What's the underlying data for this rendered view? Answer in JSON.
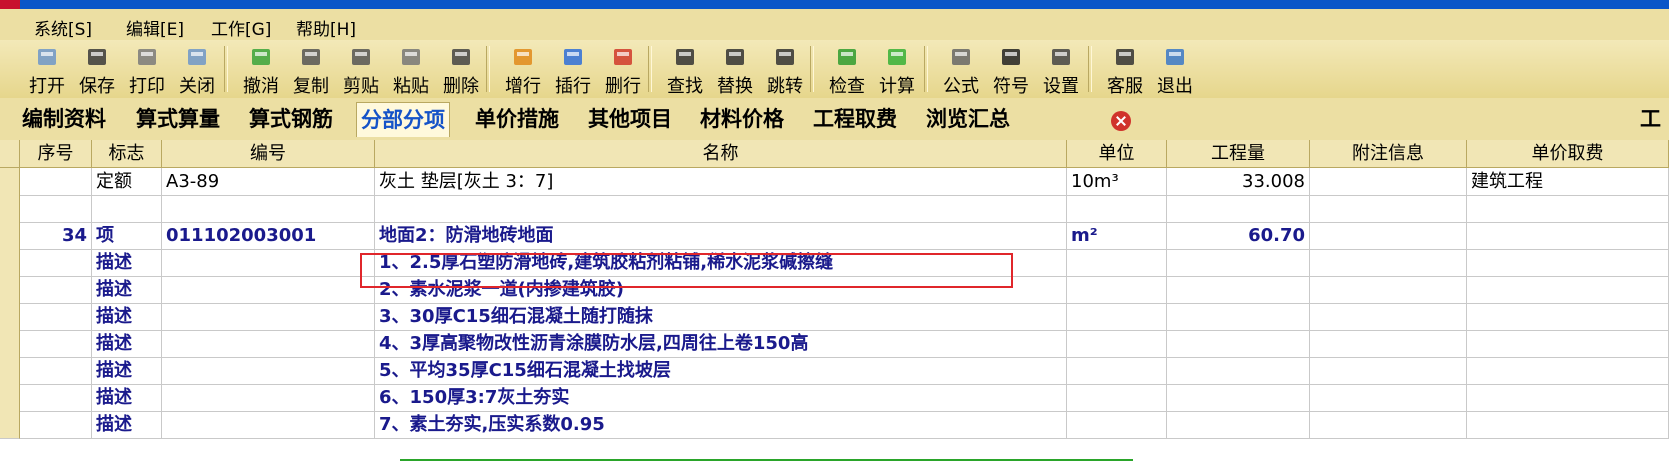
{
  "menu": [
    "系统[S]",
    "编辑[E]",
    "工作[G]",
    "帮助[H]"
  ],
  "toolbar": [
    {
      "label": "打开",
      "icon": "folder-open-icon"
    },
    {
      "label": "保存",
      "icon": "save-icon"
    },
    {
      "label": "打印",
      "icon": "printer-icon"
    },
    {
      "label": "关闭",
      "icon": "folder-close-icon"
    },
    {
      "label": "撤消",
      "icon": "undo-icon"
    },
    {
      "label": "复制",
      "icon": "copy-icon"
    },
    {
      "label": "剪贴",
      "icon": "scissors-icon"
    },
    {
      "label": "粘贴",
      "icon": "paste-icon"
    },
    {
      "label": "删除",
      "icon": "trash-icon"
    },
    {
      "label": "增行",
      "icon": "add-row-icon"
    },
    {
      "label": "插行",
      "icon": "insert-row-icon"
    },
    {
      "label": "删行",
      "icon": "delete-row-icon"
    },
    {
      "label": "查找",
      "icon": "binoculars-icon"
    },
    {
      "label": "替换",
      "icon": "replace-icon"
    },
    {
      "label": "跳转",
      "icon": "jump-icon"
    },
    {
      "label": "检查",
      "icon": "check-icon"
    },
    {
      "label": "计算",
      "icon": "calculate-icon"
    },
    {
      "label": "公式",
      "icon": "calculator-icon"
    },
    {
      "label": "符号",
      "icon": "symbol-icon"
    },
    {
      "label": "设置",
      "icon": "tools-icon"
    },
    {
      "label": "客服",
      "icon": "headset-icon"
    },
    {
      "label": "退出",
      "icon": "exit-icon"
    }
  ],
  "tabs": [
    "编制资料",
    "算式算量",
    "算式钢筋",
    "分部分项",
    "单价措施",
    "其他项目",
    "材料价格",
    "工程取费",
    "浏览汇总"
  ],
  "active_tab": "分部分项",
  "tab_overflow": "工",
  "columns": [
    "序号",
    "标志",
    "编号",
    "名称",
    "单位",
    "工程量",
    "附注信息",
    "单价取费"
  ],
  "rows": [
    {
      "seq": "",
      "flag": "定额",
      "code": "A3-89",
      "name": "灰土 垫层[灰土 3：7]",
      "unit": "10m³",
      "qty": "33.008",
      "note": "",
      "fee": "建筑工程",
      "bold": false
    },
    {
      "seq": "",
      "flag": "",
      "code": "",
      "name": "",
      "unit": "",
      "qty": "",
      "note": "",
      "fee": "",
      "bold": false
    },
    {
      "seq": "34",
      "flag": "项",
      "code": "011102003001",
      "name": "地面2：防滑地砖地面",
      "unit": "m²",
      "qty": "60.70",
      "note": "",
      "fee": "",
      "bold": true
    },
    {
      "seq": "",
      "flag": "描述",
      "code": "",
      "name": "1、2.5厚石塑防滑地砖,建筑胶粘剂粘铺,稀水泥浆碱擦缝",
      "unit": "",
      "qty": "",
      "note": "",
      "fee": "",
      "bold": true
    },
    {
      "seq": "",
      "flag": "描述",
      "code": "",
      "name": "2、素水泥浆一道(内掺建筑胶)",
      "unit": "",
      "qty": "",
      "note": "",
      "fee": "",
      "bold": true
    },
    {
      "seq": "",
      "flag": "描述",
      "code": "",
      "name": "3、30厚C15细石混凝土随打随抹",
      "unit": "",
      "qty": "",
      "note": "",
      "fee": "",
      "bold": true
    },
    {
      "seq": "",
      "flag": "描述",
      "code": "",
      "name": "4、3厚高聚物改性沥青涂膜防水层,四周往上卷150高",
      "unit": "",
      "qty": "",
      "note": "",
      "fee": "",
      "bold": true
    },
    {
      "seq": "",
      "flag": "描述",
      "code": "",
      "name": "5、平均35厚C15细石混凝土找坡层",
      "unit": "",
      "qty": "",
      "note": "",
      "fee": "",
      "bold": true
    },
    {
      "seq": "",
      "flag": "描述",
      "code": "",
      "name": "6、150厚3:7灰土夯实",
      "unit": "",
      "qty": "",
      "note": "",
      "fee": "",
      "bold": true
    },
    {
      "seq": "",
      "flag": "描述",
      "code": "",
      "name": "7、素土夯实,压实系数0.95",
      "unit": "",
      "qty": "",
      "note": "",
      "fee": "",
      "bold": true
    }
  ]
}
